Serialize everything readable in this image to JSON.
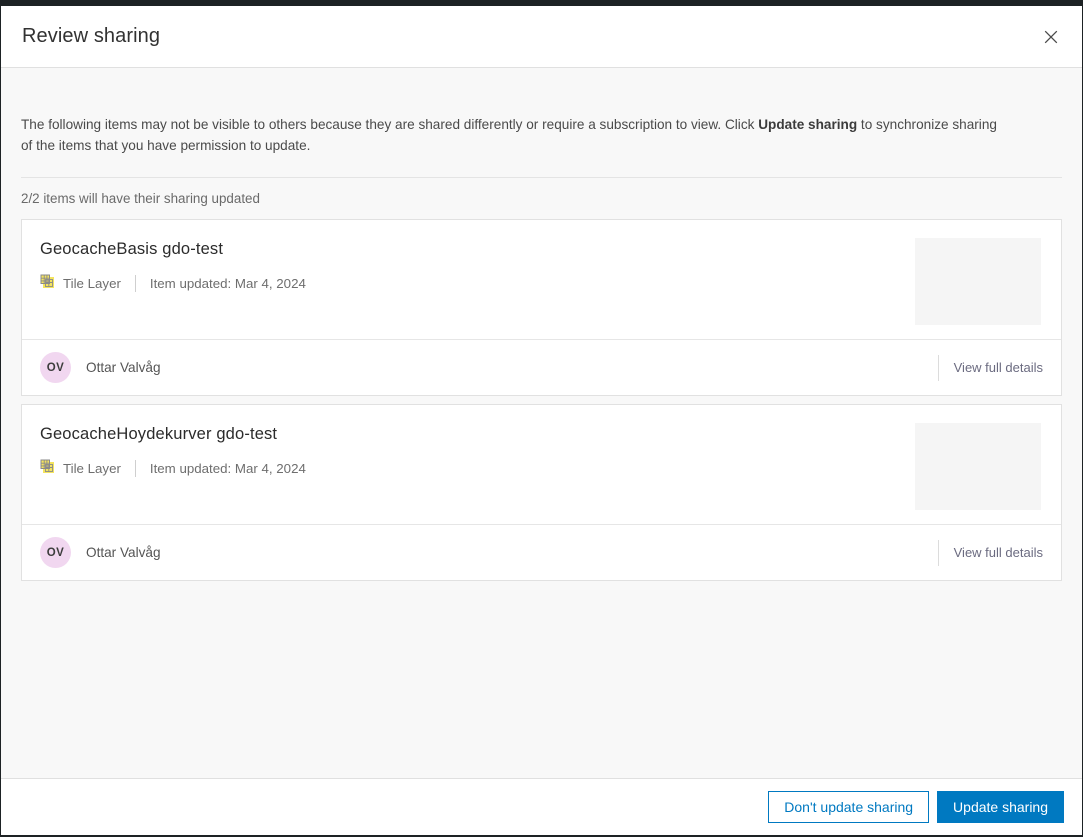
{
  "modal": {
    "title": "Review sharing",
    "close_icon": "close-icon",
    "description_part1": "The following items may not be visible to others because they are shared differently or require a subscription to view. Click ",
    "description_bold": "Update sharing",
    "description_part2": " to synchronize sharing of the items that you have permission to update.",
    "count_text": "2/2 items will have their sharing updated"
  },
  "items": [
    {
      "title": "GeocacheBasis gdo-test",
      "type_icon": "tile-layer-icon",
      "type": "Tile Layer",
      "updated": "Item updated: Mar 4, 2024",
      "owner_initials": "OV",
      "owner_name": "Ottar Valvåg",
      "details_link": "View full details"
    },
    {
      "title": "GeocacheHoydekurver gdo-test",
      "type_icon": "tile-layer-icon",
      "type": "Tile Layer",
      "updated": "Item updated: Mar 4, 2024",
      "owner_initials": "OV",
      "owner_name": "Ottar Valvåg",
      "details_link": "View full details"
    }
  ],
  "footer": {
    "secondary_label": "Don't update sharing",
    "primary_label": "Update sharing"
  },
  "colors": {
    "accent_blue": "#0079c1",
    "body_background": "#f8f8f8",
    "avatar_background": "#f1d7f0",
    "tile_icon_yellow": "#f2e15c"
  }
}
